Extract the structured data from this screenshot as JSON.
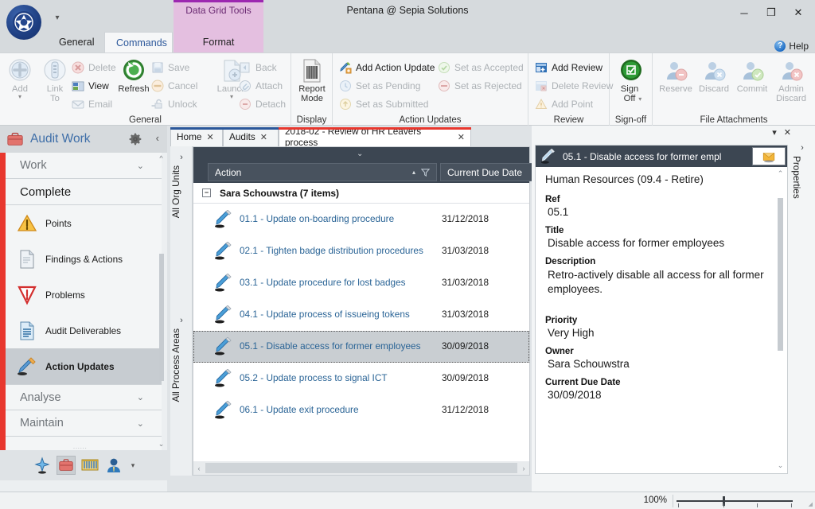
{
  "window": {
    "title": "Pentana @ Sepia Solutions",
    "minimize": "─",
    "maximize": "❒",
    "close": "✕",
    "qat_caret": "▾"
  },
  "ribbon": {
    "help_label": "Help",
    "help_icon": "question-mark",
    "tabs": [
      {
        "label": "General",
        "active": false
      },
      {
        "label": "Commands",
        "active": true
      }
    ],
    "contextual": {
      "title": "Data Grid Tools",
      "tab": "Format",
      "color": "#9c27b0",
      "bg": "#e4bfe0"
    },
    "groups": [
      {
        "label": "General",
        "big": [
          {
            "label": "Add",
            "icon": "add-icon",
            "enabled": false,
            "caret": "▾"
          },
          {
            "label": "Link\nTo",
            "icon": "link-to-icon",
            "enabled": false,
            "caret": "▾"
          },
          {
            "label": "Refresh",
            "icon": "refresh-icon",
            "enabled": true
          },
          {
            "label": "Launch",
            "icon": "launch-icon",
            "enabled": false,
            "caret": "▾"
          }
        ],
        "small_col1": [
          {
            "label": "Delete",
            "icon": "delete-icon",
            "enabled": false
          },
          {
            "label": "View",
            "icon": "view-icon",
            "enabled": true
          },
          {
            "label": "Email",
            "icon": "email-icon",
            "enabled": false
          }
        ],
        "small_col2": [
          {
            "label": "Save",
            "icon": "save-icon",
            "enabled": false
          },
          {
            "label": "Cancel",
            "icon": "cancel-icon",
            "enabled": false
          },
          {
            "label": "Unlock",
            "icon": "unlock-icon",
            "enabled": false
          }
        ],
        "small_col3": [
          {
            "label": "Back",
            "icon": "back-icon",
            "enabled": false
          },
          {
            "label": "Attach",
            "icon": "attach-icon",
            "enabled": false
          },
          {
            "label": "Detach",
            "icon": "detach-icon",
            "enabled": false
          }
        ]
      },
      {
        "label": "Display",
        "big": [
          {
            "label": "Report\nMode",
            "icon": "report-mode-icon",
            "enabled": true
          }
        ]
      },
      {
        "label": "Action Updates",
        "small_col1": [
          {
            "label": "Add Action Update",
            "icon": "add-action-update-icon",
            "enabled": true
          },
          {
            "label": "Set as Pending",
            "icon": "set-pending-icon",
            "enabled": false
          },
          {
            "label": "Set as Submitted",
            "icon": "set-submitted-icon",
            "enabled": false
          }
        ],
        "small_col2": [
          {
            "label": "Set as Accepted",
            "icon": "set-accepted-icon",
            "enabled": false
          },
          {
            "label": "Set as Rejected",
            "icon": "set-rejected-icon",
            "enabled": false
          }
        ]
      },
      {
        "label": "Review",
        "small_col1": [
          {
            "label": "Add Review",
            "icon": "add-review-icon",
            "enabled": true
          },
          {
            "label": "Delete Review",
            "icon": "delete-review-icon",
            "enabled": false
          },
          {
            "label": "Add Point",
            "icon": "add-point-icon",
            "enabled": false
          }
        ]
      },
      {
        "label": "Sign-off",
        "big": [
          {
            "label": "Sign\nOff",
            "icon": "sign-off-icon",
            "enabled": true,
            "caret": "▾"
          }
        ]
      },
      {
        "label": "File Attachments",
        "big": [
          {
            "label": "Reserve",
            "icon": "reserve-icon",
            "enabled": false
          },
          {
            "label": "Discard",
            "icon": "discard-icon",
            "enabled": false
          },
          {
            "label": "Commit",
            "icon": "commit-icon",
            "enabled": false
          },
          {
            "label": "Admin\nDiscard",
            "icon": "admin-discard-icon",
            "enabled": false
          }
        ]
      }
    ]
  },
  "sidebar": {
    "title": "Audit Work",
    "gear_icon": "gear-icon",
    "collapse_icon": "chevron-left-icon",
    "sections": [
      {
        "label": "Work",
        "type": "section",
        "chevron": "⌄"
      },
      {
        "label": "Complete",
        "type": "header"
      }
    ],
    "items": [
      {
        "label": "Points",
        "icon": "warning-triangle-icon",
        "active": false
      },
      {
        "label": "Findings & Actions",
        "icon": "document-icon",
        "active": false
      },
      {
        "label": "Problems",
        "icon": "problem-icon",
        "active": false
      },
      {
        "label": "Audit Deliverables",
        "icon": "deliverables-icon",
        "active": false
      },
      {
        "label": "Action Updates",
        "icon": "action-updates-icon",
        "active": true
      }
    ],
    "bottom_sections": [
      {
        "label": "Analyse",
        "chevron": "⌄"
      },
      {
        "label": "Maintain",
        "chevron": "⌄"
      }
    ],
    "footer_icons": [
      {
        "name": "explore-icon",
        "selected": false
      },
      {
        "name": "audit-work-icon",
        "selected": true
      },
      {
        "name": "reporting-icon",
        "selected": false
      },
      {
        "name": "admin-icon",
        "selected": false
      }
    ],
    "footer_caret": "▾"
  },
  "doc_tabs": [
    {
      "label": "Home",
      "close": "✕",
      "active": false,
      "accent": "#2b579a"
    },
    {
      "label": "Audits",
      "close": "✕",
      "active": false,
      "accent": "#2b579a"
    },
    {
      "label": "2018-02 - Review of HR Leavers process",
      "close": "✕",
      "active": true,
      "accent": "#e8372e"
    }
  ],
  "side_tabs": [
    {
      "label": "All Org Units",
      "chevron": "›"
    },
    {
      "label": "All Process Areas",
      "chevron": "›"
    }
  ],
  "grid": {
    "dropdown_icon": "⌄",
    "columns": [
      {
        "label": "Action",
        "sort": "▴",
        "filter_icon": "filter-icon"
      },
      {
        "label": "Current Due Date"
      }
    ],
    "group": {
      "label": "Sara Schouwstra (7 items)",
      "expander": "−"
    },
    "rows": [
      {
        "icon": "action-icon",
        "action": "01.1 - Update on-boarding procedure",
        "due": "31/12/2018",
        "selected": false
      },
      {
        "icon": "action-icon",
        "action": "02.1 - Tighten badge distribution procedures",
        "due": "31/03/2018",
        "selected": false
      },
      {
        "icon": "action-icon",
        "action": "03.1 - Update procedure for lost badges",
        "due": "31/03/2018",
        "selected": false
      },
      {
        "icon": "action-icon",
        "action": "04.1 - Update process of issueing tokens",
        "due": "31/03/2018",
        "selected": false
      },
      {
        "icon": "action-icon",
        "action": "05.1 - Disable access for former employees",
        "due": "30/09/2018",
        "selected": true
      },
      {
        "icon": "action-icon",
        "action": "05.2 - Update process to signal ICT",
        "due": "30/09/2018",
        "selected": false
      },
      {
        "icon": "action-icon",
        "action": "06.1 - Update exit procedure",
        "due": "31/12/2018",
        "selected": false
      }
    ],
    "hscroll": {
      "left": "‹",
      "right": "›"
    }
  },
  "properties": {
    "vtab_label": "Properties",
    "vtab_chevron": "›",
    "pin_icon": "▾",
    "close_icon": "✕",
    "header": {
      "icon": "action-icon",
      "title": "05.1 - Disable access for former empl",
      "button_icon": "notes-icon"
    },
    "subtitle": "Human Resources (09.4 - Retire)",
    "fields": [
      {
        "label": "Ref",
        "value": "05.1"
      },
      {
        "label": "Title",
        "value": "Disable access for former employees"
      },
      {
        "label": "Description",
        "value": "Retro-actively disable all access for all former employees."
      },
      {
        "label": "Priority",
        "value": "Very High"
      },
      {
        "label": "Owner",
        "value": "Sara Schouwstra"
      },
      {
        "label": "Current Due Date",
        "value": "30/09/2018"
      }
    ],
    "scroll_up": "⌃",
    "scroll_down": "⌄"
  },
  "statusbar": {
    "zoom": "100%"
  },
  "colors": {
    "accent_blue": "#2b579a",
    "red_accent": "#e8372e",
    "grid_header": "#3c4652",
    "link_blue": "#2a6496",
    "contextual_purple": "#9c27b0"
  }
}
